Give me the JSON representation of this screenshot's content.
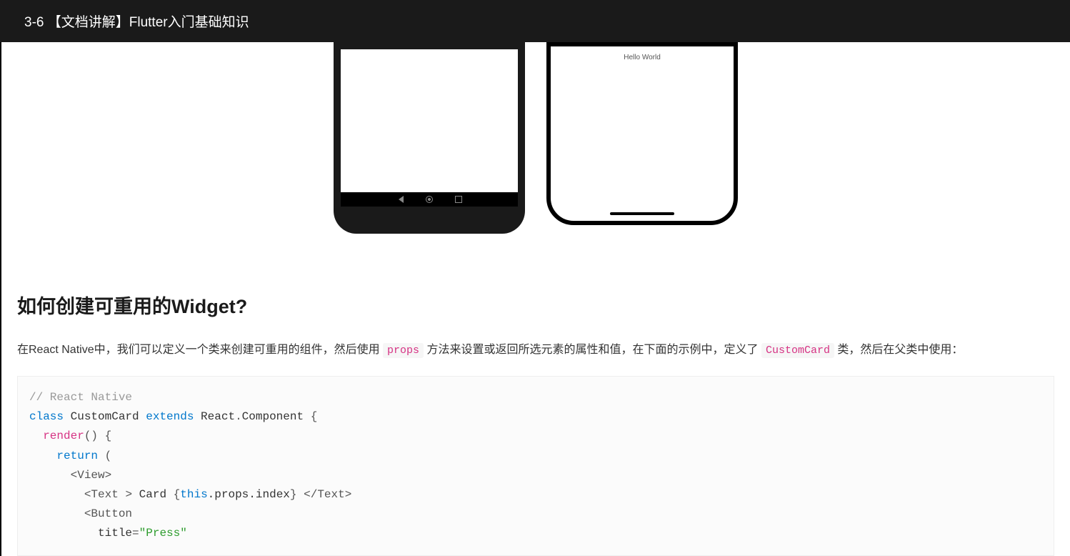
{
  "header": {
    "title": "3-6 【文档讲解】Flutter入门基础知识"
  },
  "phones": {
    "ios_screen_text": "Hello World"
  },
  "section": {
    "heading": "如何创建可重用的Widget?",
    "paragraph_parts": {
      "p1": "在React Native中，我们可以定义一个类来创建可重用的组件，然后使用 ",
      "code1": "props",
      "p2": " 方法来设置或返回所选元素的属性和值，在下面的示例中，定义了 ",
      "code2": "CustomCard",
      "p3": " 类，然后在父类中使用："
    }
  },
  "code": {
    "comment": "// React Native",
    "line2": {
      "class_kw": "class",
      "name": " CustomCard ",
      "extends_kw": "extends",
      "parent": " React",
      "dot": ".",
      "component": "Component ",
      "brace": "{"
    },
    "line3": {
      "indent": "  ",
      "render": "render",
      "rest": "() {"
    },
    "line4": {
      "indent": "    ",
      "return_kw": "return",
      "rest": " ("
    },
    "line5": {
      "indent": "      ",
      "open": "<",
      "tag": "View",
      "close": ">"
    },
    "line6": {
      "indent": "        ",
      "open": "<",
      "tag": "Text ",
      "close1": ">",
      "text1": " Card ",
      "brace_open": "{",
      "this_kw": "this",
      "props_path": ".props.index",
      "brace_close": "}",
      "text2": " ",
      "close_open": "</",
      "tag2": "Text",
      "close2": ">"
    },
    "line7": {
      "indent": "        ",
      "open": "<",
      "tag": "Button"
    },
    "line8": {
      "indent": "          ",
      "attr": "title",
      "eq": "=",
      "val": "\"Press\""
    }
  }
}
